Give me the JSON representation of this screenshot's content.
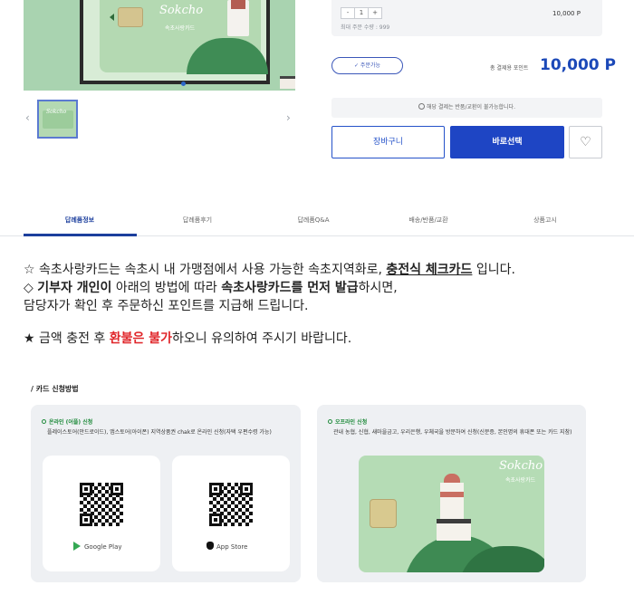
{
  "product_card": {
    "brand_script": "Sokcho",
    "name_on_card": "속초사랑카드"
  },
  "purchase": {
    "stepper": {
      "minus": "-",
      "value": "1",
      "plus": "+"
    },
    "max_note": "최대 주문 수량 : 999",
    "line_price": "10,000 P",
    "availability_label": "✓ 주문가능",
    "total_label": "총 결제용 포인트",
    "total_value": "10,000 P",
    "notice": "해당 결제는 반품/교환이 불가능합니다.",
    "cart_label": "장바구니",
    "buy_label": "바로선택",
    "wish_icon": "heart-icon"
  },
  "thumbnails": {
    "prev": "‹",
    "next": "›"
  },
  "tabs": [
    {
      "label": "답례품정보",
      "active": true
    },
    {
      "label": "답례품후기",
      "active": false
    },
    {
      "label": "답례품Q&A",
      "active": false
    },
    {
      "label": "배송/반품/교환",
      "active": false
    },
    {
      "label": "상품고시",
      "active": false
    }
  ],
  "description": {
    "l1_a": "☆ 속초사랑카드는 속초시 내 가맹점에서 사용 가능한 속초지역화로, ",
    "l1_b": "충전식 체크카드",
    "l1_c": " 입니다.",
    "l2_a": "◇ ",
    "l2_b": "기부자 개인이",
    "l2_c": " 아래의 방법에 따라 ",
    "l2_d": "속초사랑카드를 먼저 발급",
    "l2_e": "하시면,",
    "l3": "담당자가 확인 후 주문하신 포인트를 지급해 드립니다.",
    "l4_a": "★ 금액 충전 후 ",
    "l4_b": "환불은 불가",
    "l4_c": "하오니 유의하여 주시기 바랍니다."
  },
  "howto": {
    "title": "/ 카드 신청방법",
    "online": {
      "heading": "온라인 (어플) 신청",
      "text": "플레이스토어(안드로이드), 앱스토어(아이폰) 지역상품권 chak로 온라인 신청(자택 우편수령 가능)",
      "google_play": "Google Play",
      "app_store": "App Store"
    },
    "offline": {
      "heading": "오프라인 신청",
      "text": "관내 농협, 신협, 새마을금고, 우리은행, 우체국을 방문하여 신청(신분증, 본인명의 휴대폰 또는 카드 지참)",
      "card_script": "Sokcho",
      "card_name": "속초사랑카드"
    }
  }
}
